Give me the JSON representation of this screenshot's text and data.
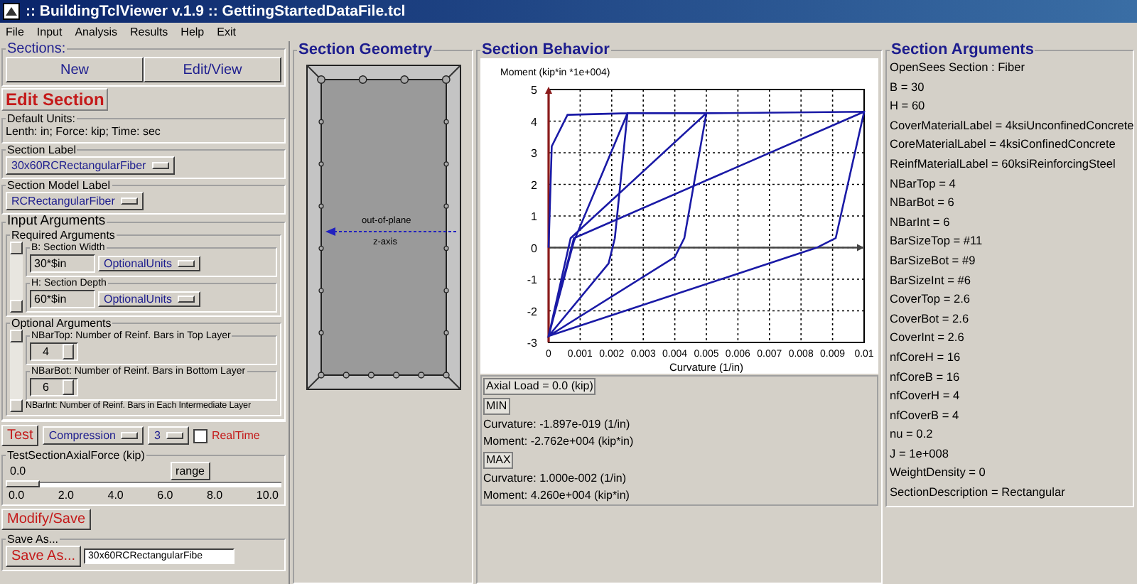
{
  "window": {
    "title": ":: BuildingTclViewer v.1.9 :: GettingStartedDataFile.tcl"
  },
  "menu": [
    "File",
    "Input",
    "Analysis",
    "Results",
    "Help",
    "Exit"
  ],
  "sections": {
    "label": "Sections:",
    "buttons": [
      "New",
      "Edit/View"
    ]
  },
  "edit_section": {
    "title": "Edit Section",
    "default_units": {
      "label": "Default Units:",
      "text": "Lenth: in; Force: kip; Time: sec"
    },
    "section_label": {
      "label": "Section Label",
      "value": "30x60RCRectangularFiber"
    },
    "section_model_label": {
      "label": "Section Model Label",
      "value": "RCRectangularFiber"
    },
    "input_arguments": {
      "label": "Input Arguments",
      "required": {
        "label": "Required Arguments",
        "fields": [
          {
            "label": "B: Section Width",
            "value": "30*$in",
            "units": "OptionalUnits"
          },
          {
            "label": "H: Section Depth",
            "value": "60*$in",
            "units": "OptionalUnits"
          }
        ]
      },
      "optional": {
        "label": "Optional Arguments",
        "fields": [
          {
            "label": "NBarTop: Number of Reinf. Bars in Top Layer",
            "value": "4"
          },
          {
            "label": "NBarBot: Number of Reinf. Bars in Bottom Layer",
            "value": "6"
          }
        ],
        "cut_label": "NBarInt: Number of Reinf. Bars in Each Intermediate Layer"
      }
    },
    "test": {
      "button": "Test",
      "mode": "Compression",
      "steps": "3",
      "realtime": {
        "label": "RealTime",
        "checked": false
      }
    },
    "axial_force": {
      "label": "TestSectionAxialForce (kip)",
      "value": "0.0",
      "level": 0,
      "button": "range",
      "ticks": [
        "0.0",
        "2.0",
        "4.0",
        "6.0",
        "8.0",
        "10.0"
      ]
    },
    "modify_button": "Modify/Save",
    "save_as": {
      "label": "Save As...",
      "button": "Save As...",
      "value": "30x60RCRectangularFibe"
    }
  },
  "geometry": {
    "title": "Section Geometry",
    "axis_label": "out-of-plane",
    "axis_name": "z-axis"
  },
  "behavior": {
    "title": "Section Behavior",
    "chart_data": {
      "type": "line",
      "ylabel": "Moment (kip*in *1e+004)",
      "xlabel": "Curvature (1/in)",
      "xlim": [
        0,
        0.01
      ],
      "ylim": [
        -3,
        5
      ],
      "xticks": [
        {
          "value": 0,
          "label": "0"
        },
        0.001,
        0.002,
        0.003,
        0.004,
        0.005,
        0.006,
        0.007,
        0.008,
        0.009,
        {
          "value": 0.01,
          "label": "0.01"
        }
      ],
      "yticks": [
        -3,
        -2,
        -1,
        0,
        1,
        2,
        3,
        4,
        5
      ],
      "x": [
        0,
        0.0001,
        0.0006,
        0.0025,
        0.0021,
        0.0019,
        0,
        0.0008,
        0.0025,
        0.005,
        0.0043,
        0.004,
        0,
        0.0007,
        0.005,
        0.01,
        0.0091,
        0.0085,
        0,
        0.0008,
        0.01
      ],
      "grid": true,
      "series": [
        {
          "color": "#1a1aa6",
          "values": [
            0,
            3.2,
            4.2,
            4.25,
            0.3,
            -0.5,
            -2.8,
            0.2,
            4.25,
            4.25,
            0.3,
            -0.3,
            -2.8,
            0.3,
            4.25,
            4.3,
            0.3,
            0,
            -2.8,
            0.3,
            4.3
          ]
        }
      ]
    },
    "axial_load": "Axial Load = 0.0 (kip)",
    "min": {
      "label": "MIN",
      "curvature": "Curvature: -1.897e-019 (1/in)",
      "moment": "Moment: -2.762e+004 (kip*in)"
    },
    "max": {
      "label": "MAX",
      "curvature": "Curvature: 1.000e-002 (1/in)",
      "moment": "Moment: 4.260e+004 (kip*in)"
    }
  },
  "arguments": {
    "title": "Section Arguments",
    "lines": [
      "OpenSees Section : Fiber",
      "B = 30",
      "H = 60",
      "CoverMaterialLabel = 4ksiUnconfinedConcrete",
      "CoreMaterialLabel = 4ksiConfinedConcrete",
      "ReinfMaterialLabel = 60ksiReinforcingSteel",
      "NBarTop = 4",
      "NBarBot = 6",
      "NBarInt = 6",
      "BarSizeTop = #11",
      "BarSizeBot = #9",
      "BarSizeInt = #6",
      "CoverTop = 2.6",
      "CoverBot = 2.6",
      "CoverInt = 2.6",
      "nfCoreH = 16",
      "nfCoreB = 16",
      "nfCoverH = 4",
      "nfCoverB = 4",
      "nu = 0.2",
      "J = 1e+008",
      "WeightDensity = 0",
      "SectionDescription = Rectangular"
    ]
  }
}
